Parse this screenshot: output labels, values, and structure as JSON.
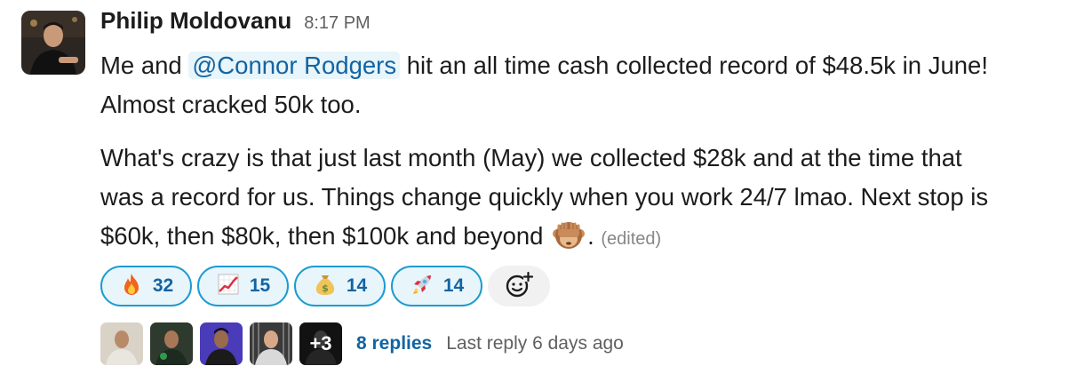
{
  "message": {
    "author": "Philip Moldovanu",
    "time": "8:17 PM",
    "p1_before": "Me and ",
    "mention": "@Connor Rodgers",
    "p1_after": " hit an all time cash collected record of $48.5k in June!",
    "p1_line2": "Almost cracked 50k too.",
    "p2_line1": "What's crazy is that just last month (May) we collected $28k and at the time that",
    "p2_line2": "was a record for us. Things change quickly when you work 24/7 lmao. Next stop is",
    "p2_line3": "$60k, then $80k, then $100k and beyond",
    "p2_end": ".",
    "edited": "(edited)",
    "inline_emoji": "see-no-evil-monkey"
  },
  "reactions": [
    {
      "emoji": "fire",
      "count": "32"
    },
    {
      "emoji": "chart-increasing",
      "count": "15"
    },
    {
      "emoji": "money-bag",
      "count": "14"
    },
    {
      "emoji": "rocket",
      "count": "14"
    }
  ],
  "thread": {
    "more_count": "+3",
    "replies": "8 replies",
    "last_reply": "Last reply 6 days ago"
  },
  "colors": {
    "link": "#1264a3",
    "reaction_border": "#1d9bd1",
    "reaction_bg": "#e8f5fa",
    "mention_bg": "#e8f5fa",
    "muted": "#616061"
  }
}
